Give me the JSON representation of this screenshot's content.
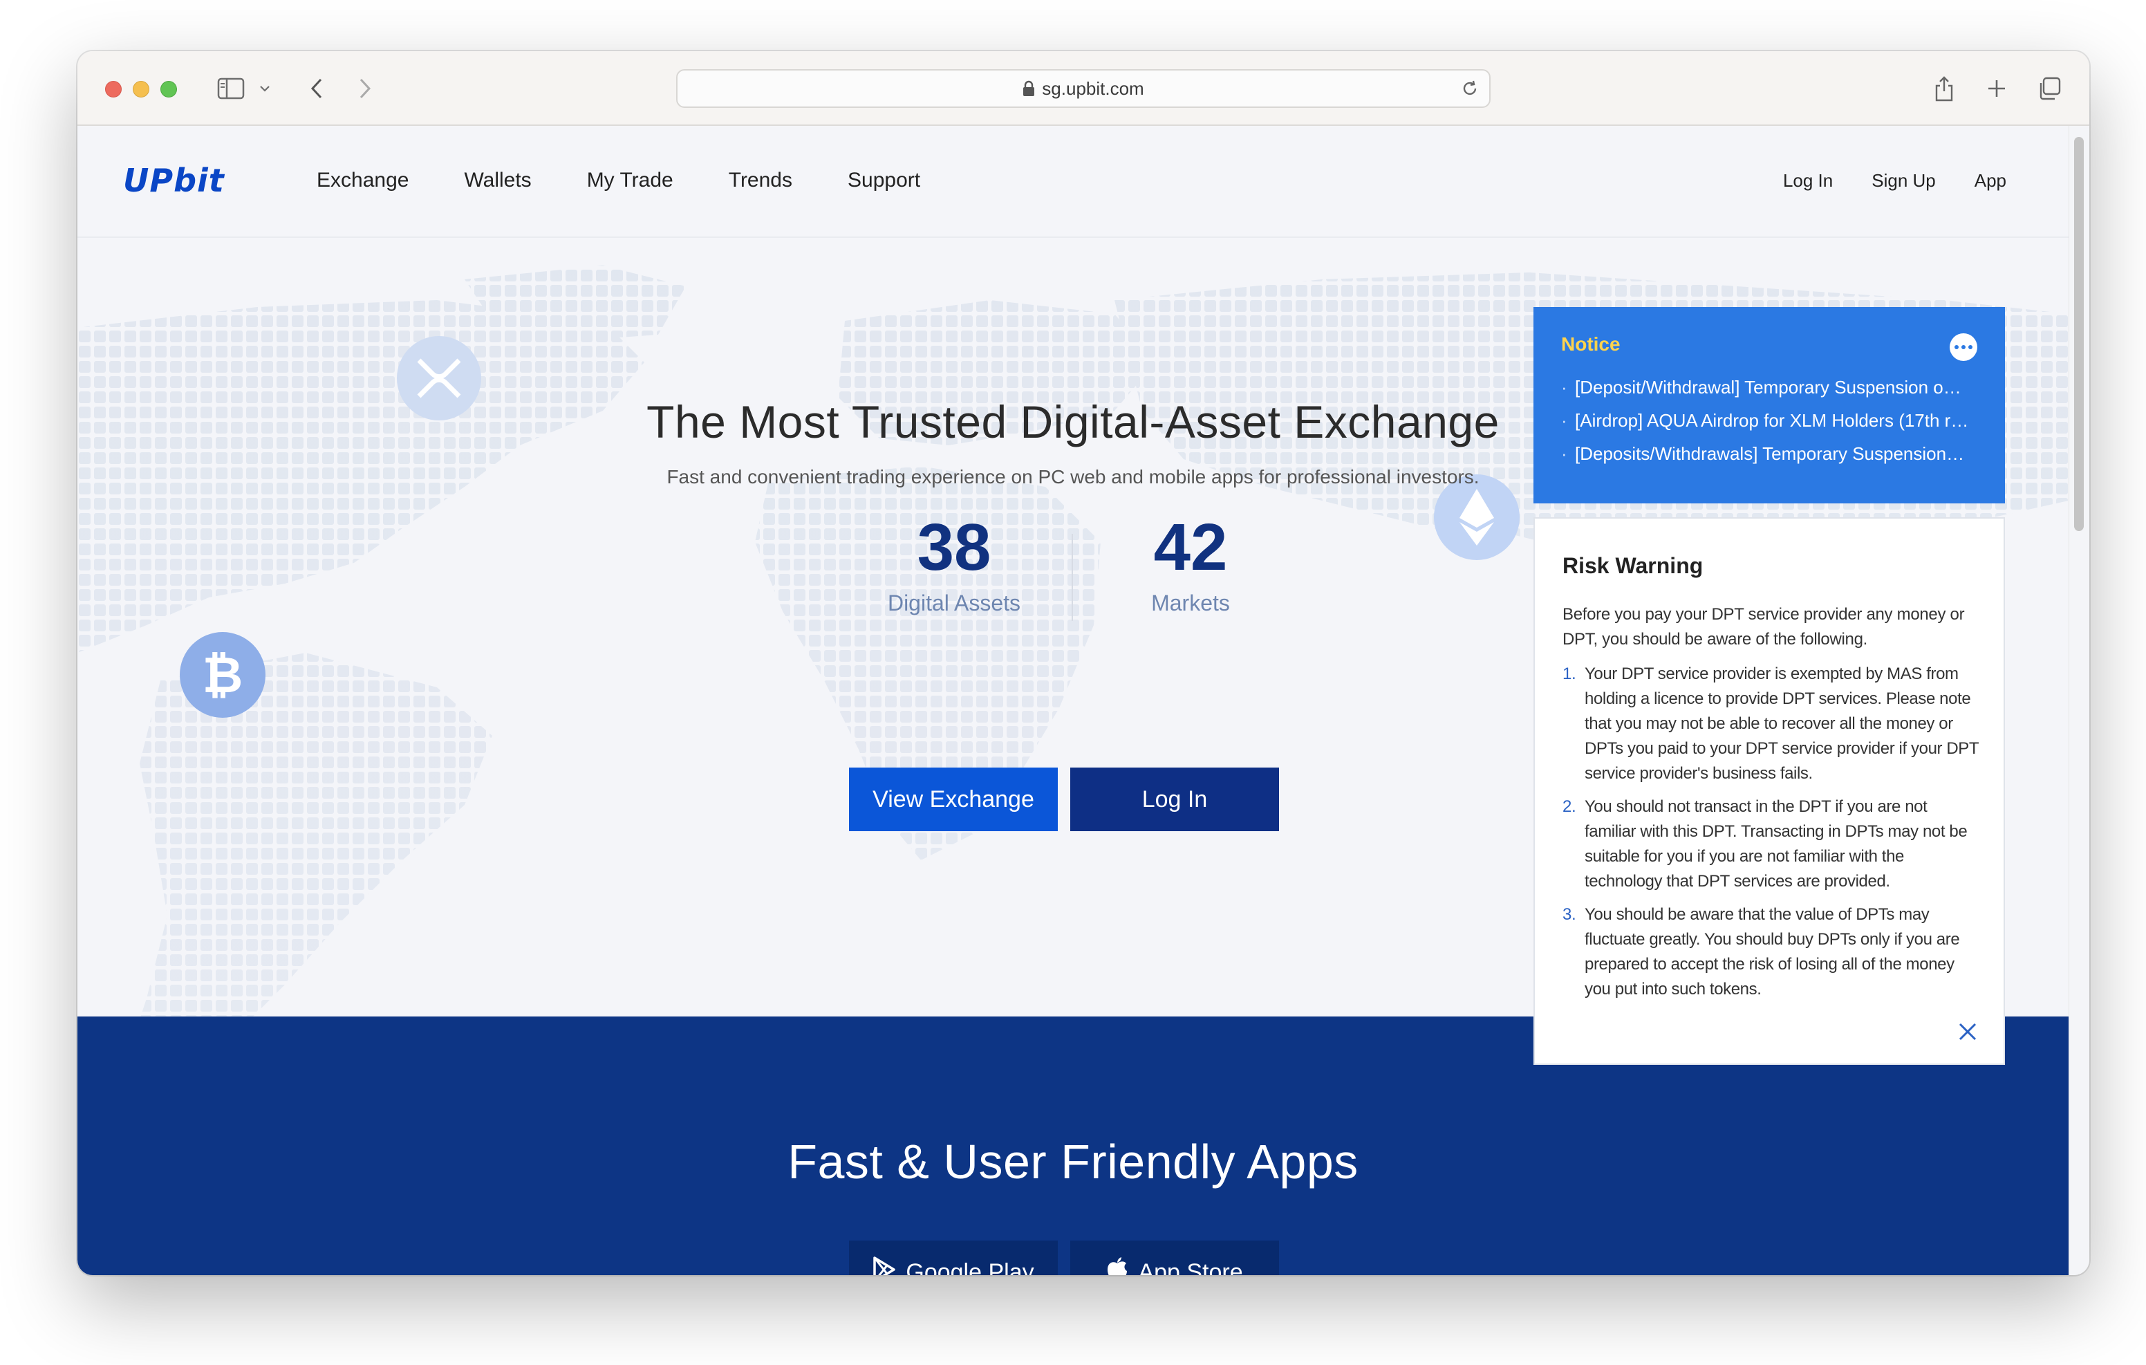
{
  "browser": {
    "url": "sg.upbit.com"
  },
  "nav": {
    "logo": "UPbit",
    "links": [
      "Exchange",
      "Wallets",
      "My Trade",
      "Trends",
      "Support"
    ],
    "right": [
      "Log In",
      "Sign Up",
      "App"
    ]
  },
  "hero": {
    "title": "The Most Trusted Digital-Asset Exchange",
    "subtitle": "Fast and convenient trading experience on PC web and mobile apps for professional investors.",
    "stats": [
      {
        "value": "38",
        "label": "Digital Assets"
      },
      {
        "value": "42",
        "label": "Markets"
      }
    ],
    "buttons": {
      "primary": "View Exchange",
      "secondary": "Log In"
    }
  },
  "notice": {
    "title": "Notice",
    "items": [
      "[Deposit/Withdrawal] Temporary Suspension o…",
      "[Airdrop] AQUA Airdrop for XLM Holders (17th r…",
      "[Deposits/Withdrawals] Temporary Suspension…"
    ]
  },
  "risk_warning": {
    "title": "Risk Warning",
    "intro": "Before you pay your DPT service provider any money or DPT, you should be aware of the following.",
    "items": [
      {
        "n": "1.",
        "text": "Your DPT service provider is exempted by MAS from holding a licence to provide DPT services. Please note that you may not be able to recover all the money or DPTs you paid to your DPT service provider if your DPT service provider's business fails."
      },
      {
        "n": "2.",
        "text": "You should not transact in the DPT if you are not familiar with this DPT. Transacting in DPTs may not be suitable for you if you are not familiar with the technology that DPT services are provided."
      },
      {
        "n": "3.",
        "text": "You should be aware that the value of DPTs may fluctuate greatly. You should buy DPTs only if you are prepared to accept the risk of losing all of the money you put into such tokens."
      }
    ]
  },
  "apps": {
    "title": "Fast & User Friendly Apps",
    "google_play": "Google Play",
    "app_store": "App Store"
  },
  "colors": {
    "brand": "#0a46c6",
    "primary_button": "#0b56d8",
    "dark_button": "#0e2f85",
    "notice_bg": "#2b79e3",
    "notice_title": "#ffd34d",
    "apps_band": "#0d3585"
  }
}
